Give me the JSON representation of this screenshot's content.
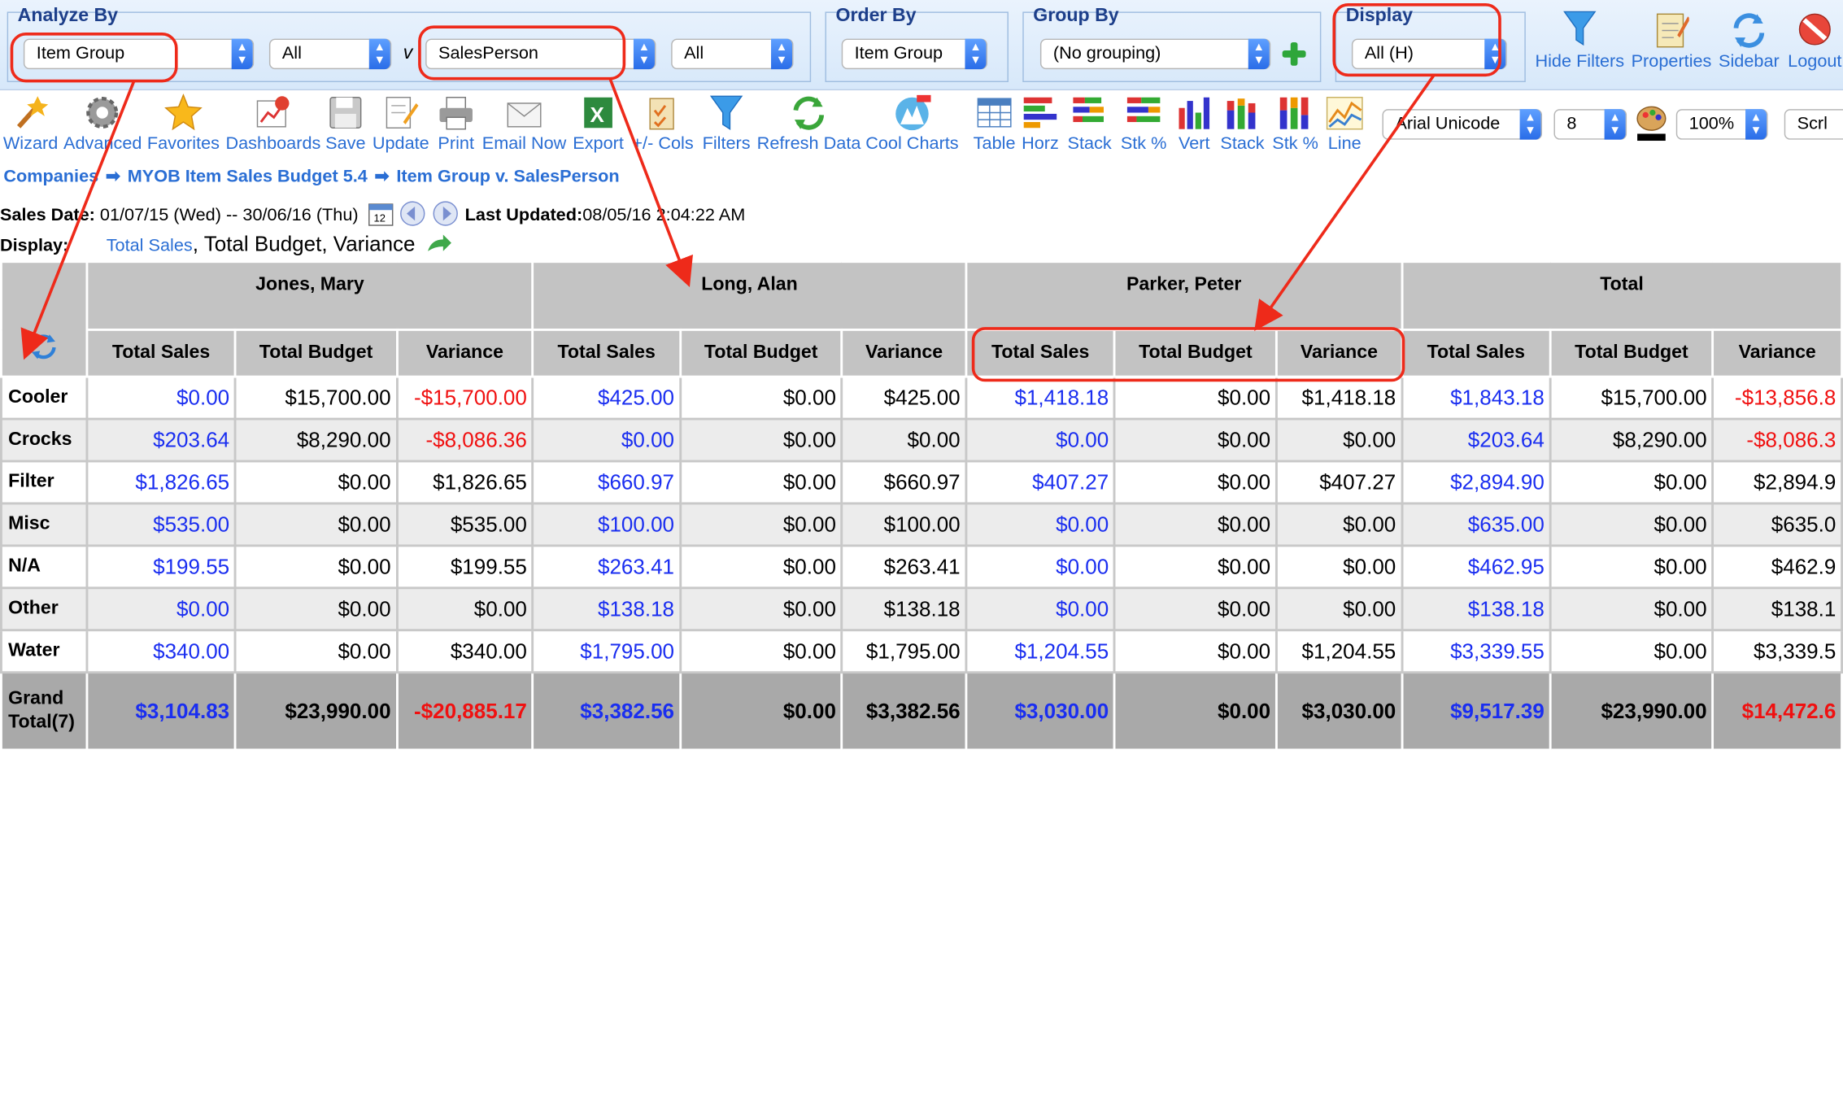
{
  "filters": {
    "analyze_by": {
      "title": "Analyze By",
      "field1": "Item Group",
      "filter1": "All",
      "separator": "v",
      "field2": "SalesPerson",
      "filter2": "All"
    },
    "order_by": {
      "title": "Order By",
      "value": "Item Group"
    },
    "group_by": {
      "title": "Group By",
      "value": "(No grouping)"
    },
    "display": {
      "title": "Display",
      "value": "All (H)"
    }
  },
  "top_buttons": [
    "Hide Filters",
    "Properties",
    "Sidebar",
    "Logout"
  ],
  "toolbar": {
    "items": [
      "Wizard",
      "Advanced",
      "Favorites",
      "Dashboards",
      "Save",
      "Update",
      "Print",
      "Email Now",
      "Export",
      "+/- Cols",
      "Filters",
      "Refresh Data",
      "Cool Charts"
    ],
    "chart_items": [
      "Table",
      "Horz",
      "Stack",
      "Stk %",
      "Vert",
      "Stack",
      "Stk %",
      "Line"
    ],
    "font": "Arial Unicode",
    "font_size": "8",
    "zoom": "100%",
    "scroll_label": "Scrl"
  },
  "breadcrumb": [
    "Companies",
    "MYOB Item Sales Budget 5.4",
    "Item Group v. SalesPerson"
  ],
  "info": {
    "sales_date_label": "Sales Date:",
    "sales_date": "01/07/15 (Wed) -- 30/06/16 (Thu)",
    "last_updated_label": "Last Updated:",
    "last_updated": "08/05/16 2:04:22 AM"
  },
  "display_line": {
    "label": "Display:",
    "link": "Total Sales",
    "rest": ", Total Budget, Variance"
  },
  "grid": {
    "groups": [
      "Jones, Mary",
      "Long, Alan",
      "Parker, Peter",
      "Total"
    ],
    "columns": [
      "Total Sales",
      "Total Budget",
      "Variance"
    ],
    "rows": [
      {
        "label": "Cooler",
        "cells": [
          "$0.00",
          "$15,700.00",
          "-$15,700.00",
          "$425.00",
          "$0.00",
          "$425.00",
          "$1,418.18",
          "$0.00",
          "$1,418.18",
          "$1,843.18",
          "$15,700.00",
          "-$13,856.8"
        ]
      },
      {
        "label": "Crocks",
        "cells": [
          "$203.64",
          "$8,290.00",
          "-$8,086.36",
          "$0.00",
          "$0.00",
          "$0.00",
          "$0.00",
          "$0.00",
          "$0.00",
          "$203.64",
          "$8,290.00",
          "-$8,086.3"
        ]
      },
      {
        "label": "Filter",
        "cells": [
          "$1,826.65",
          "$0.00",
          "$1,826.65",
          "$660.97",
          "$0.00",
          "$660.97",
          "$407.27",
          "$0.00",
          "$407.27",
          "$2,894.90",
          "$0.00",
          "$2,894.9"
        ]
      },
      {
        "label": "Misc",
        "cells": [
          "$535.00",
          "$0.00",
          "$535.00",
          "$100.00",
          "$0.00",
          "$100.00",
          "$0.00",
          "$0.00",
          "$0.00",
          "$635.00",
          "$0.00",
          "$635.0"
        ]
      },
      {
        "label": "N/A",
        "cells": [
          "$199.55",
          "$0.00",
          "$199.55",
          "$263.41",
          "$0.00",
          "$263.41",
          "$0.00",
          "$0.00",
          "$0.00",
          "$462.95",
          "$0.00",
          "$462.9"
        ]
      },
      {
        "label": "Other",
        "cells": [
          "$0.00",
          "$0.00",
          "$0.00",
          "$138.18",
          "$0.00",
          "$138.18",
          "$0.00",
          "$0.00",
          "$0.00",
          "$138.18",
          "$0.00",
          "$138.1"
        ]
      },
      {
        "label": "Water",
        "cells": [
          "$340.00",
          "$0.00",
          "$340.00",
          "$1,795.00",
          "$0.00",
          "$1,795.00",
          "$1,204.55",
          "$0.00",
          "$1,204.55",
          "$3,339.55",
          "$0.00",
          "$3,339.5"
        ]
      }
    ],
    "grand_total": {
      "label_line1": "Grand",
      "label_line2": "Total(7)",
      "cells": [
        "$3,104.83",
        "$23,990.00",
        "-$20,885.17",
        "$3,382.56",
        "$0.00",
        "$3,382.56",
        "$3,030.00",
        "$0.00",
        "$3,030.00",
        "$9,517.39",
        "$23,990.00",
        "$14,472.6"
      ]
    }
  },
  "colors": {
    "sales": "#1a2ef0",
    "negative": "#f01010",
    "header_bg": "#c3c3c3",
    "annotation": "#ee2a1a",
    "link": "#2a6ed4"
  }
}
